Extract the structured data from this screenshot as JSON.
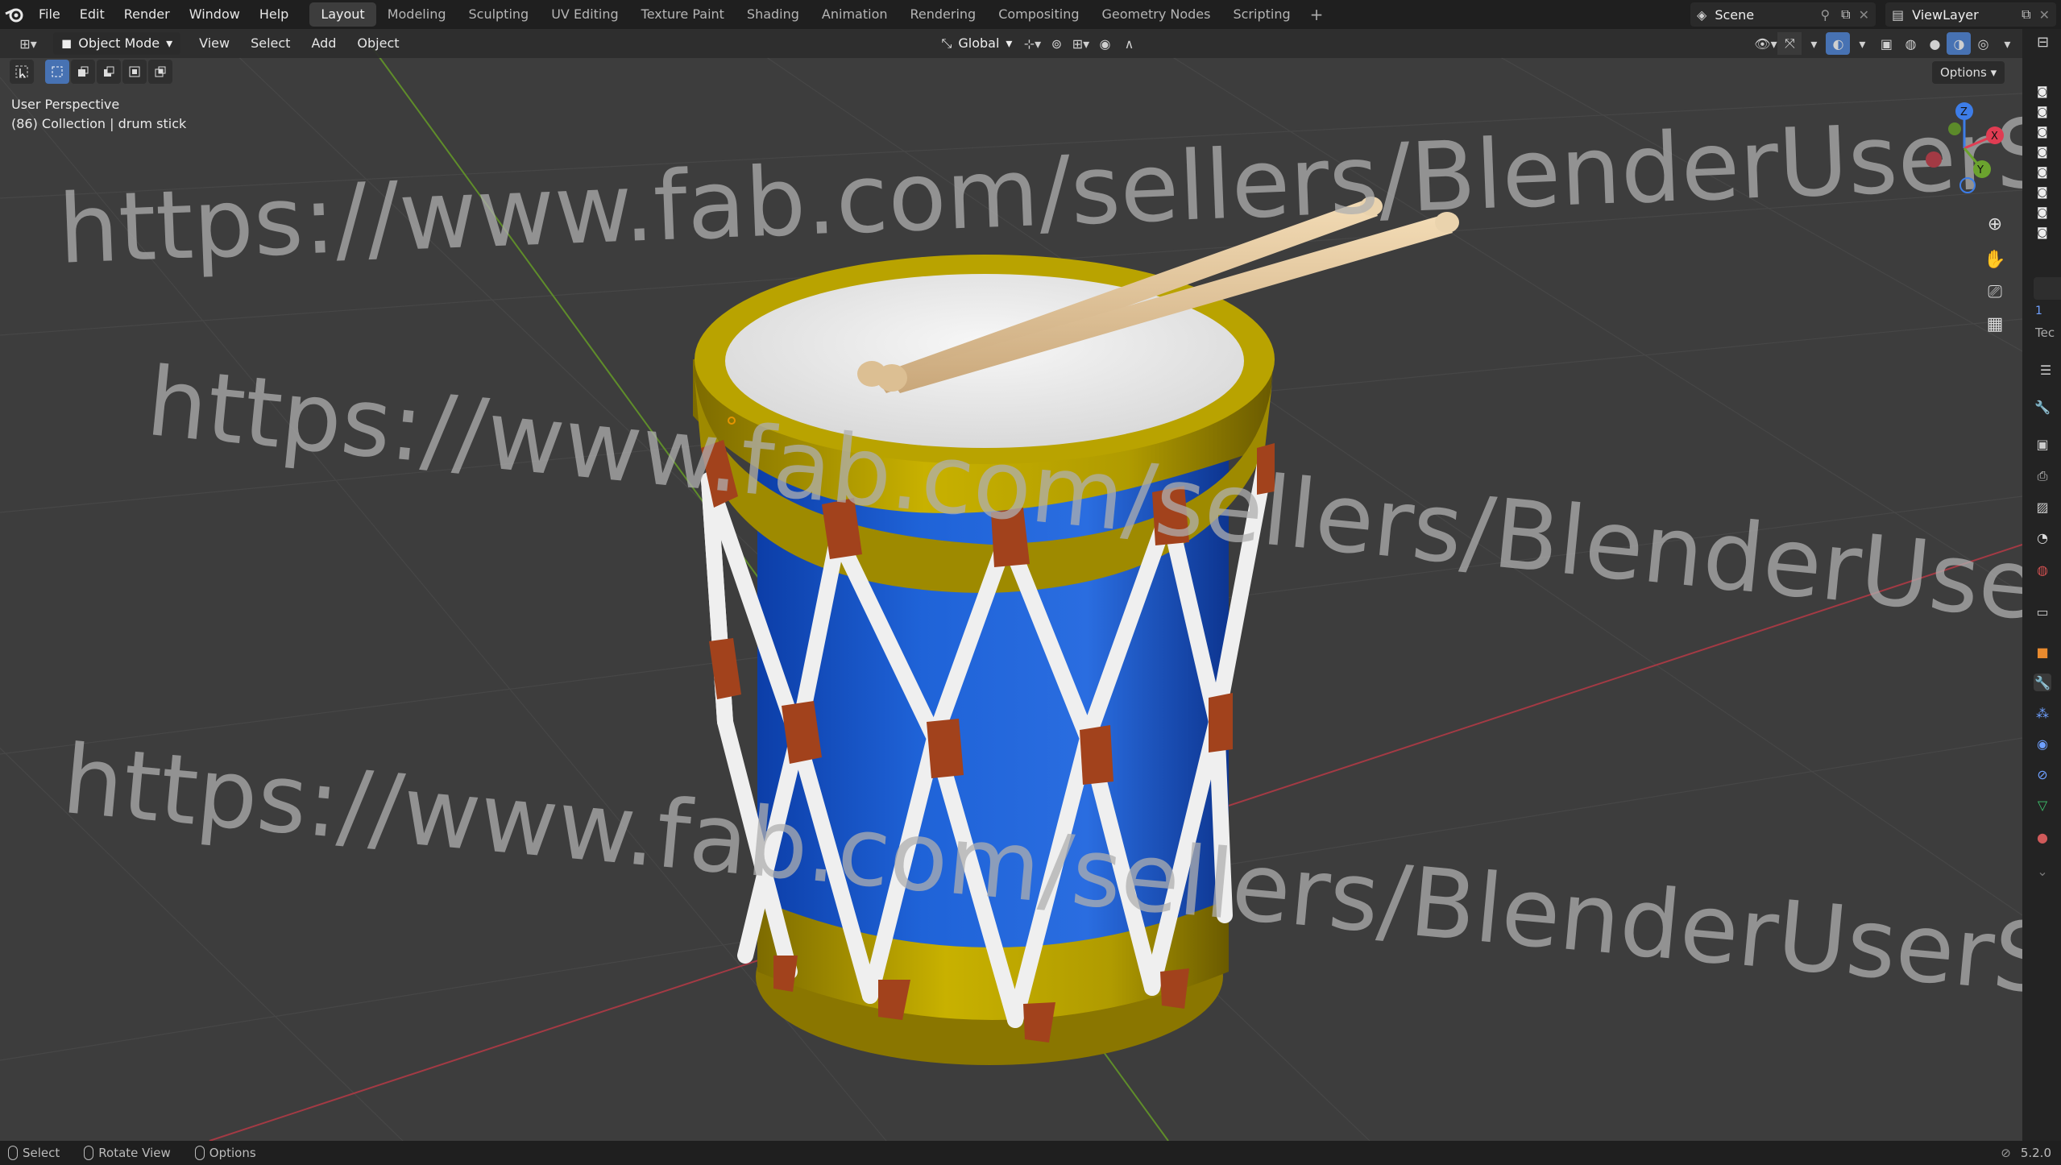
{
  "menu": [
    "File",
    "Edit",
    "Render",
    "Window",
    "Help"
  ],
  "tabs": [
    "Layout",
    "Modeling",
    "Sculpting",
    "UV Editing",
    "Texture Paint",
    "Shading",
    "Animation",
    "Rendering",
    "Compositing",
    "Geometry Nodes",
    "Scripting"
  ],
  "scene": {
    "label": "Scene"
  },
  "view_layer": {
    "label": "ViewLayer"
  },
  "header": {
    "mode": "Object Mode",
    "view": "View",
    "select": "Select",
    "add": "Add",
    "object": "Object",
    "orientation": "Global",
    "options": "Options"
  },
  "viewport": {
    "perspective": "User Perspective",
    "collection": "(86) Collection | drum stick",
    "watermark": "https://www.fab.com/sellers/BlenderUserSkfb"
  },
  "side_panel": {
    "tab_label": "Tec",
    "count": "1"
  },
  "status": {
    "select": "Select",
    "rotate": "Rotate View",
    "options": "Options",
    "version": "5.2.0"
  },
  "colors": {
    "accent": "#4772b3",
    "drum_body": "#1f5fd0",
    "drum_rim": "#b8a300",
    "rope": "#f0f0f0",
    "tab_leather": "#a2421c",
    "stick": "#e8cfa6"
  }
}
